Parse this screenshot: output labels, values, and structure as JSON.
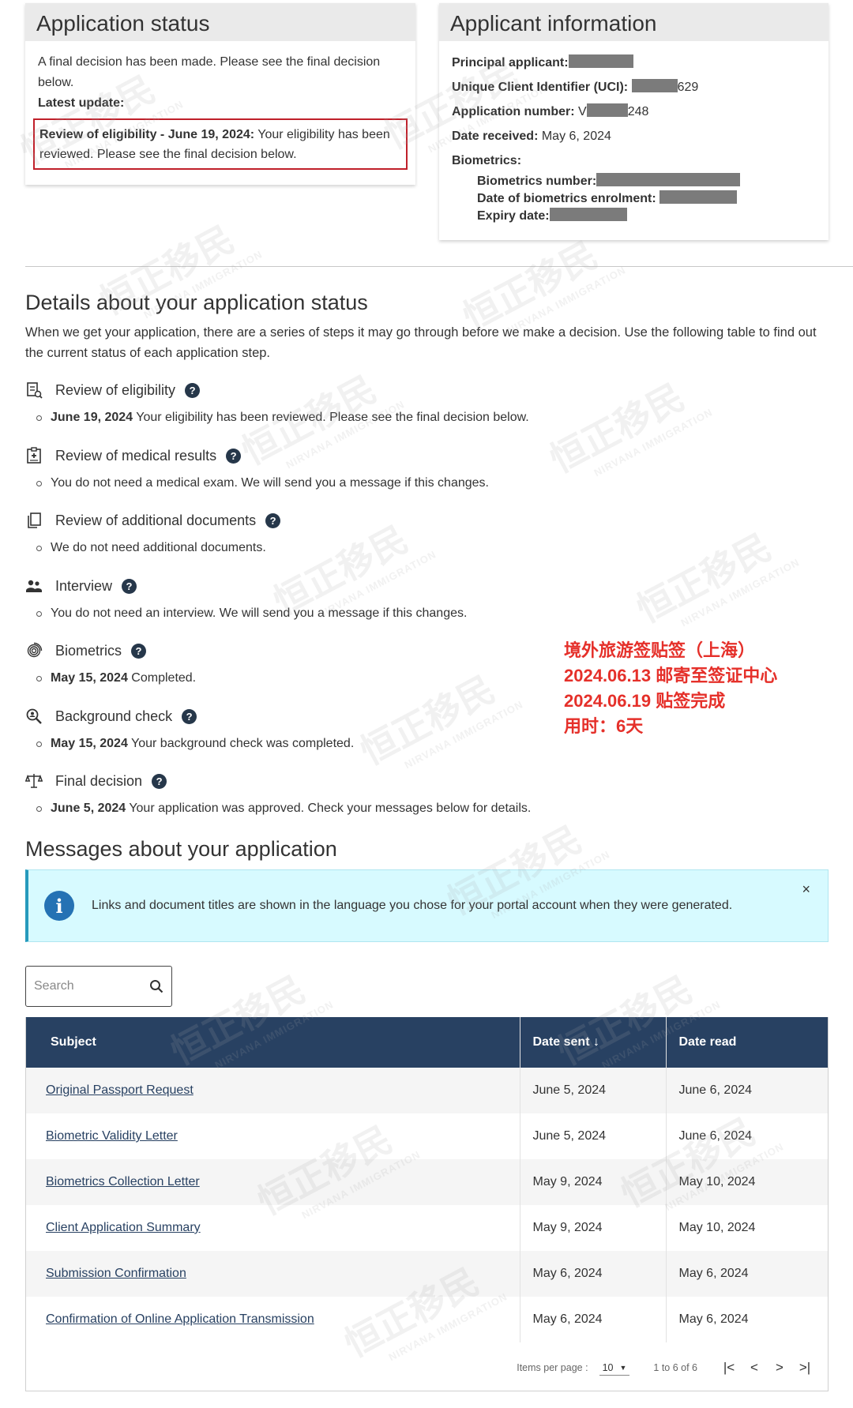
{
  "status_card": {
    "title": "Application status",
    "final_text": "A final decision has been made. Please see the final decision below.",
    "latest_label": "Latest update:",
    "update_bold": "Review of eligibility - June 19, 2024:",
    "update_text": " Your eligibility has been reviewed. Please see the final decision below."
  },
  "applicant_card": {
    "title": "Applicant information",
    "principal_label": "Principal applicant:",
    "uci_label": "Unique Client Identifier (UCI):",
    "uci_suffix": "629",
    "app_number_label": "Application number:",
    "app_number_prefix": "V",
    "app_number_suffix": "248",
    "date_received_label": "Date received:",
    "date_received": "May 6, 2024",
    "biometrics_label": "Biometrics:",
    "bio_number_label": "Biometrics number:",
    "bio_date_label": "Date of biometrics enrolment:",
    "expiry_label": "Expiry date:"
  },
  "details": {
    "title": "Details about your application status",
    "intro": "When we get your application, there are a series of steps it may go through before we make a decision. Use the following table to find out the current status of each application step.",
    "steps": [
      {
        "title": "Review of eligibility",
        "date": "June 19, 2024",
        "text": " Your eligibility has been reviewed. Please see the final decision below."
      },
      {
        "title": "Review of medical results",
        "date": "",
        "text": "You do not need a medical exam. We will send you a message if this changes."
      },
      {
        "title": "Review of additional documents",
        "date": "",
        "text": "We do not need additional documents."
      },
      {
        "title": "Interview",
        "date": "",
        "text": "You do not need an interview. We will send you a message if this changes."
      },
      {
        "title": "Biometrics",
        "date": "May 15, 2024",
        "text": " Completed."
      },
      {
        "title": "Background check",
        "date": "May 15, 2024",
        "text": " Your background check was completed."
      },
      {
        "title": "Final decision",
        "date": "June 5, 2024",
        "text": " Your application was approved. Check your messages below for details."
      }
    ],
    "help_symbol": "?"
  },
  "overlay_note": {
    "line1": "境外旅游签贴签（上海）",
    "line2": "2024.06.13 邮寄至签证中心",
    "line3": "2024.06.19 贴签完成",
    "line4": "用时：6天",
    "color": "#e5302a"
  },
  "messages": {
    "title": "Messages about your application",
    "alert_icon": "i",
    "alert_text": "Links and document titles are shown in the language you chose for your portal account when they were generated.",
    "alert_close": "×",
    "search_placeholder": "Search",
    "columns": {
      "subject": "Subject",
      "date_sent": "Date sent ↓",
      "date_read": "Date read"
    },
    "rows": [
      {
        "subject": "Original Passport Request",
        "sent": "June 5, 2024",
        "read": "June 6, 2024"
      },
      {
        "subject": "Biometric Validity Letter",
        "sent": "June 5, 2024",
        "read": "June 6, 2024"
      },
      {
        "subject": "Biometrics Collection Letter",
        "sent": "May 9, 2024",
        "read": "May 10, 2024"
      },
      {
        "subject": "Client Application Summary",
        "sent": "May 9, 2024",
        "read": "May 10, 2024"
      },
      {
        "subject": "Submission Confirmation",
        "sent": "May 6, 2024",
        "read": "May 6, 2024"
      },
      {
        "subject": "Confirmation of Online Application Transmission",
        "sent": "May 6, 2024",
        "read": "May 6, 2024"
      }
    ],
    "pager": {
      "items_label": "Items per page :",
      "per_page": "10",
      "range": "1 to 6 of 6",
      "first": "|<",
      "prev": "<",
      "next": ">",
      "last": ">|"
    }
  },
  "watermark": {
    "cn": "恒正移民",
    "en": "NIRVANA IMMIGRATION"
  },
  "colors": {
    "header_navy": "#284162",
    "alert_bg": "#d7faff",
    "highlight_red": "#c0202a",
    "help_navy": "#26374a"
  }
}
